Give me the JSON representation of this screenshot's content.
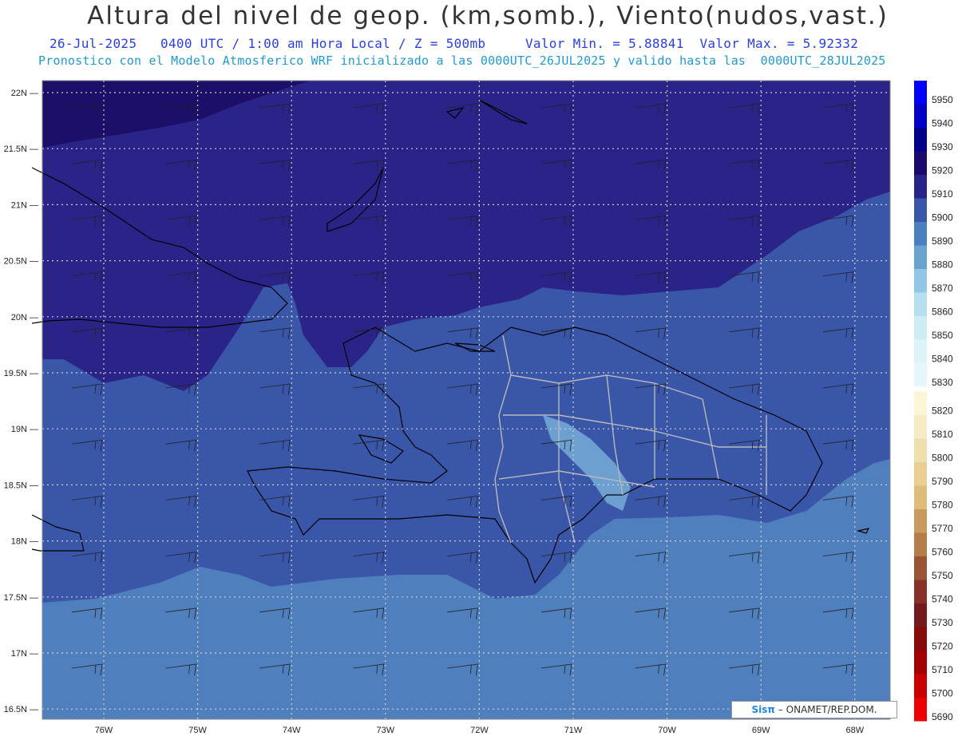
{
  "title": "Altura del nivel de geop. (km,somb.), Viento(nudos,vast.)",
  "subtitle_line1": "26-Jul-2025   0400 UTC / 1:00 am Hora Local / Z = 500mb     Valor Min. = 5.88841  Valor Max. = 5.92332",
  "subtitle_line2": "Pronostico con el Modelo Atmosferico WRF inicializado a las 0000UTC_26JUL2025 y valido hasta las  0000UTC_28JUL2025",
  "credit": {
    "logo": "Sisπ",
    "text": "– ONAMET/REP.DOM."
  },
  "axes": {
    "lat_labels": [
      "22N",
      "21.5N",
      "21N",
      "20.5N",
      "20N",
      "19.5N",
      "19N",
      "18.5N",
      "18N",
      "17.5N",
      "17N",
      "16.5N"
    ],
    "lon_labels": [
      "76W",
      "75W",
      "74W",
      "73W",
      "72W",
      "71W",
      "70W",
      "69W",
      "68W"
    ]
  },
  "colorbar": {
    "levels": [
      5950,
      5940,
      5930,
      5920,
      5910,
      5900,
      5890,
      5880,
      5870,
      5860,
      5850,
      5840,
      5830,
      5820,
      5810,
      5800,
      5790,
      5780,
      5770,
      5760,
      5750,
      5740,
      5730,
      5720,
      5710,
      5700,
      5690
    ],
    "colors": [
      "#0000ff",
      "#0000c8",
      "#00008c",
      "#1a0a6e",
      "#2a2489",
      "#3a56a8",
      "#4c7fc0",
      "#6aa3d2",
      "#92c6e4",
      "#b6e0f0",
      "#cdecf6",
      "#ddf2f9",
      "#e6f7fb",
      "#fdf6d6",
      "#f6ebc4",
      "#efdeae",
      "#e9cf94",
      "#dfbb7c",
      "#c99a5e",
      "#b57c48",
      "#9b5534",
      "#873029",
      "#741a1c",
      "#860a08",
      "#a50000",
      "#c80000",
      "#ee0000"
    ]
  },
  "regions": [
    {
      "name": "5920-5930",
      "color": "#1c0f68"
    },
    {
      "name": "5910-5920",
      "color": "#2a2489"
    },
    {
      "name": "5900-5910",
      "color": "#3a56a8"
    },
    {
      "name": "5890-5900",
      "color": "#4f7fbd"
    },
    {
      "name": "5880-5890",
      "color": "#6d9fd0"
    }
  ]
}
